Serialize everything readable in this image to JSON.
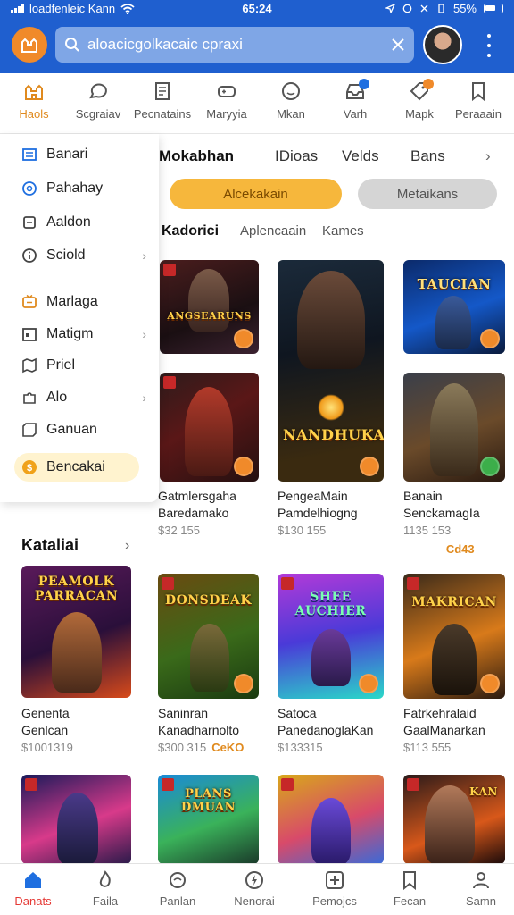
{
  "statusbar": {
    "carrier": "loadfenleic Kann",
    "time": "65:24",
    "battery": "55%"
  },
  "header": {
    "search_placeholder": "aloacicgolkacaic cpraxi"
  },
  "topcats": [
    {
      "label": "Haols",
      "icon": "castle-icon",
      "active": true
    },
    {
      "label": "Scgraiav",
      "icon": "chat-icon"
    },
    {
      "label": "Pecnatains",
      "icon": "document-icon"
    },
    {
      "label": "Maryyia",
      "icon": "gamepad-icon"
    },
    {
      "label": "Mkan",
      "icon": "smile-icon"
    },
    {
      "label": "Varh",
      "icon": "inbox-icon"
    },
    {
      "label": "Mapk",
      "icon": "tag-icon"
    },
    {
      "label": "Peraaain",
      "icon": "bookmark-icon"
    }
  ],
  "drawer": [
    {
      "label": "Banari",
      "icon": "list-icon",
      "chevron": false
    },
    {
      "label": "Pahahay",
      "icon": "target-icon",
      "chevron": false
    },
    {
      "label": "Aaldon",
      "icon": "box-icon",
      "chevron": false
    },
    {
      "label": "Sciold",
      "icon": "info-icon",
      "chevron": true
    },
    {
      "label": "Marlaga",
      "icon": "tv-icon",
      "chevron": false
    },
    {
      "label": "Matigm",
      "icon": "calendar-icon",
      "chevron": true
    },
    {
      "label": "Priel",
      "icon": "map-icon",
      "chevron": false
    },
    {
      "label": "Alo",
      "icon": "puzzle-icon",
      "chevron": true
    },
    {
      "label": "Ganuan",
      "icon": "frame-icon",
      "chevron": false
    },
    {
      "label": "Bencakai",
      "icon": "coin-icon",
      "chevron": false,
      "highlight": true
    }
  ],
  "tabs": [
    "Mokabhan",
    "IDioas",
    "Velds",
    "Bans"
  ],
  "filters": {
    "primary": "Alcekakain",
    "secondary": "Metaikans"
  },
  "subtabs": [
    "Kadorici",
    "Aplencaain",
    "Kames"
  ],
  "row1": [
    {
      "cover_title": "ANGSEARUNS",
      "line1": "Gatmlersgaha",
      "line2": "Baredamako",
      "price": "$32 155"
    },
    {
      "cover_title": "NANDHUKA",
      "line1": "PengeaMain",
      "line2": "Pamdelhiogng",
      "price": "$130 155"
    },
    {
      "cover_title": "TAUCIAN",
      "line1": "Banain",
      "line2": "SenckamagIa",
      "price": "1135 153",
      "tag": "Cd43"
    }
  ],
  "section": {
    "title": "Kataliai"
  },
  "row2": [
    {
      "cover_title": "PEAMOLK PARRACAN",
      "line1": "Genenta",
      "line2": "Genlcan",
      "price": "$1001319"
    },
    {
      "cover_title": "DONSDEAK",
      "line1": "Saninran",
      "line2": "Kanadharnolto",
      "price": "$300 315",
      "tag": "CeKO"
    },
    {
      "cover_title": "SHEE AUCHIER",
      "line1": "Satoca",
      "line2": "PanedanoglaKan",
      "price": "$133315"
    },
    {
      "cover_title": "MAKRICAN",
      "line1": "Fatrkehralaid",
      "line2": "GaalManarkan",
      "price": "$113 555"
    }
  ],
  "row3": [
    {
      "cover_title": ""
    },
    {
      "cover_title": "PLANS DMUAN"
    },
    {
      "cover_title": ""
    },
    {
      "cover_title": "KAN"
    }
  ],
  "bottomnav": [
    {
      "label": "Danats",
      "icon": "home-icon",
      "active": true
    },
    {
      "label": "Faila",
      "icon": "fire-icon"
    },
    {
      "label": "Panlan",
      "icon": "planet-icon"
    },
    {
      "label": "Nenorai",
      "icon": "bolt-icon"
    },
    {
      "label": "Pemojcs",
      "icon": "plus-box-icon"
    },
    {
      "label": "Fecan",
      "icon": "bookmark-icon"
    },
    {
      "label": "Samn",
      "icon": "user-icon"
    }
  ],
  "colors": {
    "header": "#1f5fcf",
    "accent": "#f6b73c",
    "active_nav": "#e53935",
    "active_cat": "#e08a1e"
  }
}
